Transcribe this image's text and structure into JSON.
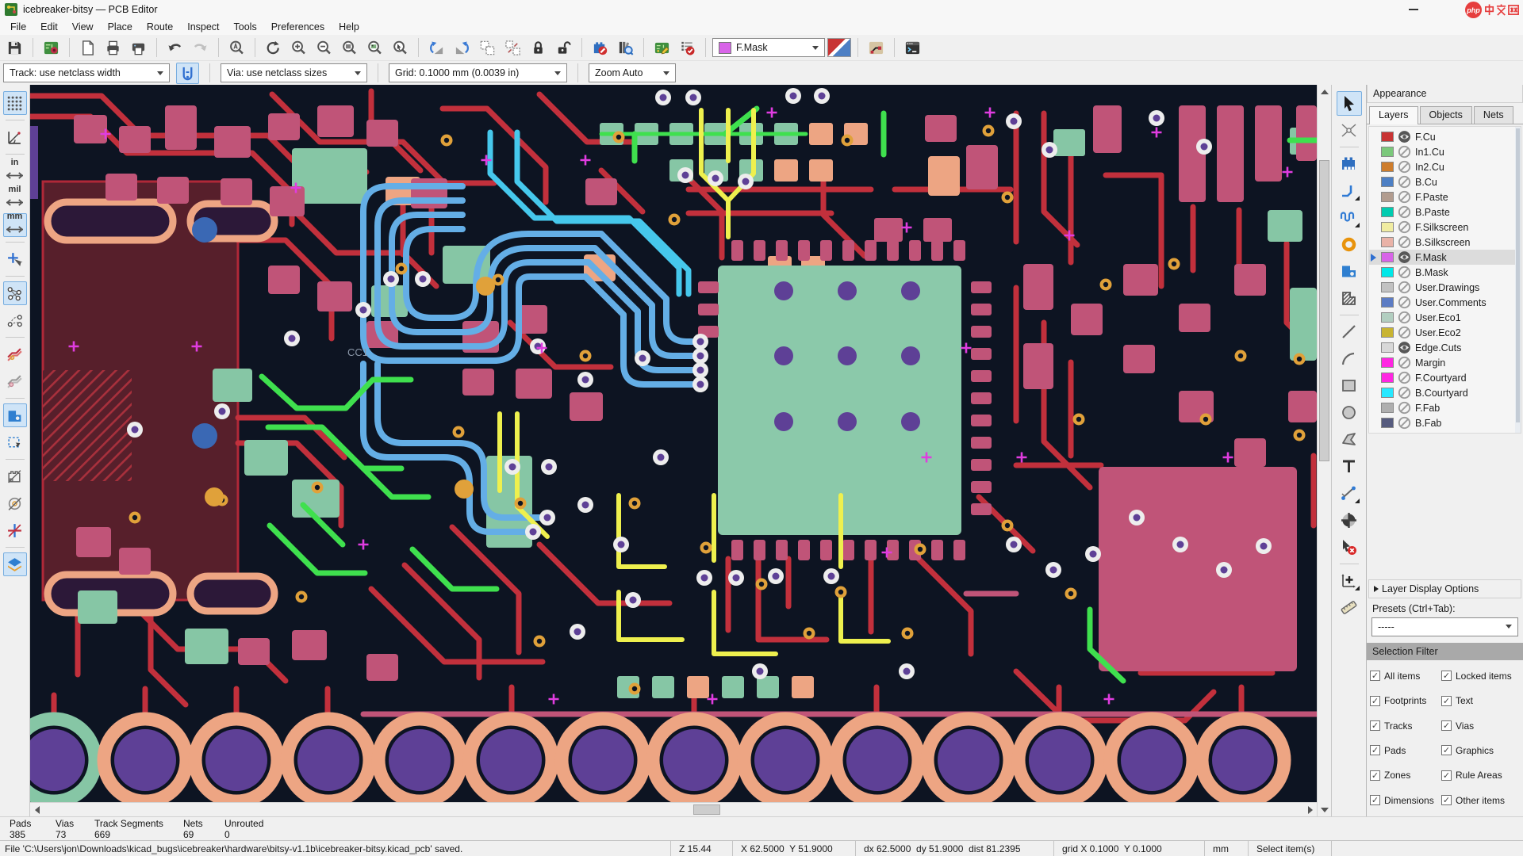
{
  "window": {
    "title": "icebreaker-bitsy — PCB Editor"
  },
  "watermark": {
    "logo_text": "php",
    "cjk_text": "中文网",
    "color": "#E63E3E"
  },
  "menu": {
    "items": [
      "File",
      "Edit",
      "View",
      "Place",
      "Route",
      "Inspect",
      "Tools",
      "Preferences",
      "Help"
    ]
  },
  "toolbar": {
    "layer_selector": {
      "value": "F.Mask",
      "swatch_color": "#D864E8"
    },
    "track_width": "Track: use netclass width",
    "via_size": "Via: use netclass sizes",
    "grid": "Grid: 0.1000 mm (0.0039 in)",
    "zoom": "Zoom Auto",
    "main_icons": [
      "save",
      "board-setup",
      "page-settings",
      "print",
      "plot",
      "undo",
      "redo",
      "find",
      "refresh",
      "zoom-in",
      "zoom-out",
      "zoom-fit",
      "zoom-objects",
      "zoom-selection",
      "rotate-ccw",
      "rotate-cw",
      "group",
      "ungroup",
      "lock",
      "unlock",
      "remove-unused-pads",
      "library-browser",
      "update-pcb-from-schematic",
      "design-rules-check",
      "layer-pair-indicator",
      "highlight-net",
      "scripting-console"
    ]
  },
  "left_toolbar": {
    "units_in": "in",
    "units_mil": "mil",
    "units_mm": "mm",
    "icons": [
      "grid-dots",
      "polar-coordinates",
      "units-inches",
      "units-mils",
      "units-mm",
      "crosshair-cursor",
      "show-ratsnest",
      "curved-ratsnest",
      "net-color-mode",
      "sketch-tracks",
      "zone-fill-mode",
      "zone-outline-mode",
      "sketch-footprints",
      "sketch-pads",
      "sketch-vias",
      "appearance-panel-toggle"
    ]
  },
  "right_toolbar": {
    "icons": [
      "select-tool",
      "local-ratsnest-tool",
      "add-footprint-tool",
      "route-tracks-tool",
      "tune-length-tool",
      "add-via-tool",
      "add-filled-zone-tool",
      "add-rule-area-tool",
      "draw-line-tool",
      "draw-arc-tool",
      "draw-rectangle-tool",
      "draw-circle-tool",
      "draw-polygon-tool",
      "add-text-tool",
      "add-dimension-tool",
      "drill-origin-tool",
      "delete-tool",
      "grid-origin-tool",
      "measure-tool"
    ]
  },
  "appearance": {
    "title": "Appearance",
    "tabs": [
      "Layers",
      "Objects",
      "Nets"
    ],
    "active_tab": "Layers",
    "layers": [
      {
        "name": "F.Cu",
        "color": "#C83434",
        "visible": true,
        "selected": false
      },
      {
        "name": "In1.Cu",
        "color": "#7BC87B",
        "visible": false,
        "selected": false
      },
      {
        "name": "In2.Cu",
        "color": "#CE7D2C",
        "visible": false,
        "selected": false
      },
      {
        "name": "B.Cu",
        "color": "#4D7FC4",
        "visible": false,
        "selected": false
      },
      {
        "name": "F.Paste",
        "color": "#B29C8F",
        "visible": false,
        "selected": false
      },
      {
        "name": "B.Paste",
        "color": "#00CBB0",
        "visible": false,
        "selected": false
      },
      {
        "name": "F.Silkscreen",
        "color": "#F0ECA1",
        "visible": false,
        "selected": false
      },
      {
        "name": "B.Silkscreen",
        "color": "#E9B2A7",
        "visible": false,
        "selected": false
      },
      {
        "name": "F.Mask",
        "color": "#D864E8",
        "visible": true,
        "selected": true
      },
      {
        "name": "B.Mask",
        "color": "#00E8E8",
        "visible": false,
        "selected": false
      },
      {
        "name": "User.Drawings",
        "color": "#C2C2C2",
        "visible": false,
        "selected": false
      },
      {
        "name": "User.Comments",
        "color": "#5C7CC4",
        "visible": false,
        "selected": false
      },
      {
        "name": "User.Eco1",
        "color": "#B2CEC0",
        "visible": false,
        "selected": false
      },
      {
        "name": "User.Eco2",
        "color": "#C8B432",
        "visible": false,
        "selected": false
      },
      {
        "name": "Edge.Cuts",
        "color": "#D8D8D8",
        "visible": true,
        "selected": false
      },
      {
        "name": "Margin",
        "color": "#FF26E2",
        "visible": false,
        "selected": false
      },
      {
        "name": "F.Courtyard",
        "color": "#FF26E2",
        "visible": false,
        "selected": false
      },
      {
        "name": "B.Courtyard",
        "color": "#26E8FF",
        "visible": false,
        "selected": false
      },
      {
        "name": "F.Fab",
        "color": "#AFAFAF",
        "visible": false,
        "selected": false
      },
      {
        "name": "B.Fab",
        "color": "#565B7E",
        "visible": false,
        "selected": false
      }
    ],
    "layer_display_options": "Layer Display Options",
    "presets_label": "Presets (Ctrl+Tab):",
    "presets_value": "-----"
  },
  "selection_filter": {
    "title": "Selection Filter",
    "items": [
      {
        "label": "All items",
        "checked": true
      },
      {
        "label": "Locked items",
        "checked": true
      },
      {
        "label": "Footprints",
        "checked": true
      },
      {
        "label": "Text",
        "checked": true
      },
      {
        "label": "Tracks",
        "checked": true
      },
      {
        "label": "Vias",
        "checked": true
      },
      {
        "label": "Pads",
        "checked": true
      },
      {
        "label": "Graphics",
        "checked": true
      },
      {
        "label": "Zones",
        "checked": true
      },
      {
        "label": "Rule Areas",
        "checked": true
      },
      {
        "label": "Dimensions",
        "checked": true
      },
      {
        "label": "Other items",
        "checked": true
      }
    ]
  },
  "status_counts": {
    "items": [
      {
        "label": "Pads",
        "value": "385"
      },
      {
        "label": "Vias",
        "value": "73"
      },
      {
        "label": "Track Segments",
        "value": "669"
      },
      {
        "label": "Nets",
        "value": "69"
      },
      {
        "label": "Unrouted",
        "value": "0"
      }
    ]
  },
  "status_bar": {
    "message": "File 'C:\\Users\\jon\\Downloads\\kicad_bugs\\icebreaker\\hardware\\bitsy-v1.1b\\icebreaker-bitsy.kicad_pcb' saved.",
    "zoom_level": "Z 15.44",
    "cursor_position": "X 62.5000  Y 51.9000",
    "delta": "dx 62.5000  dy 51.9000  dist 81.2395",
    "grid": "grid X 0.1000  Y 0.1000",
    "units": "mm",
    "hint": "Select item(s)"
  },
  "canvas": {
    "reference_label": "CC1",
    "background_color": "#0D1422",
    "colors": {
      "copper_trace": "#C2303C",
      "zone_fill": "#571F2B",
      "pad_rose": "#C05478",
      "pad_mint": "#86C6A5",
      "pad_salmon": "#EDA583",
      "hole_purple": "#5E4096",
      "via_orange": "#E0A13A",
      "trace_blue": "#64AEE6",
      "trace_cyan": "#46C8EC",
      "trace_green": "#3FE04E",
      "trace_yellow": "#EEF04E",
      "annular_white": "#EDEDED",
      "cross_magenta": "#E03CE0"
    }
  }
}
